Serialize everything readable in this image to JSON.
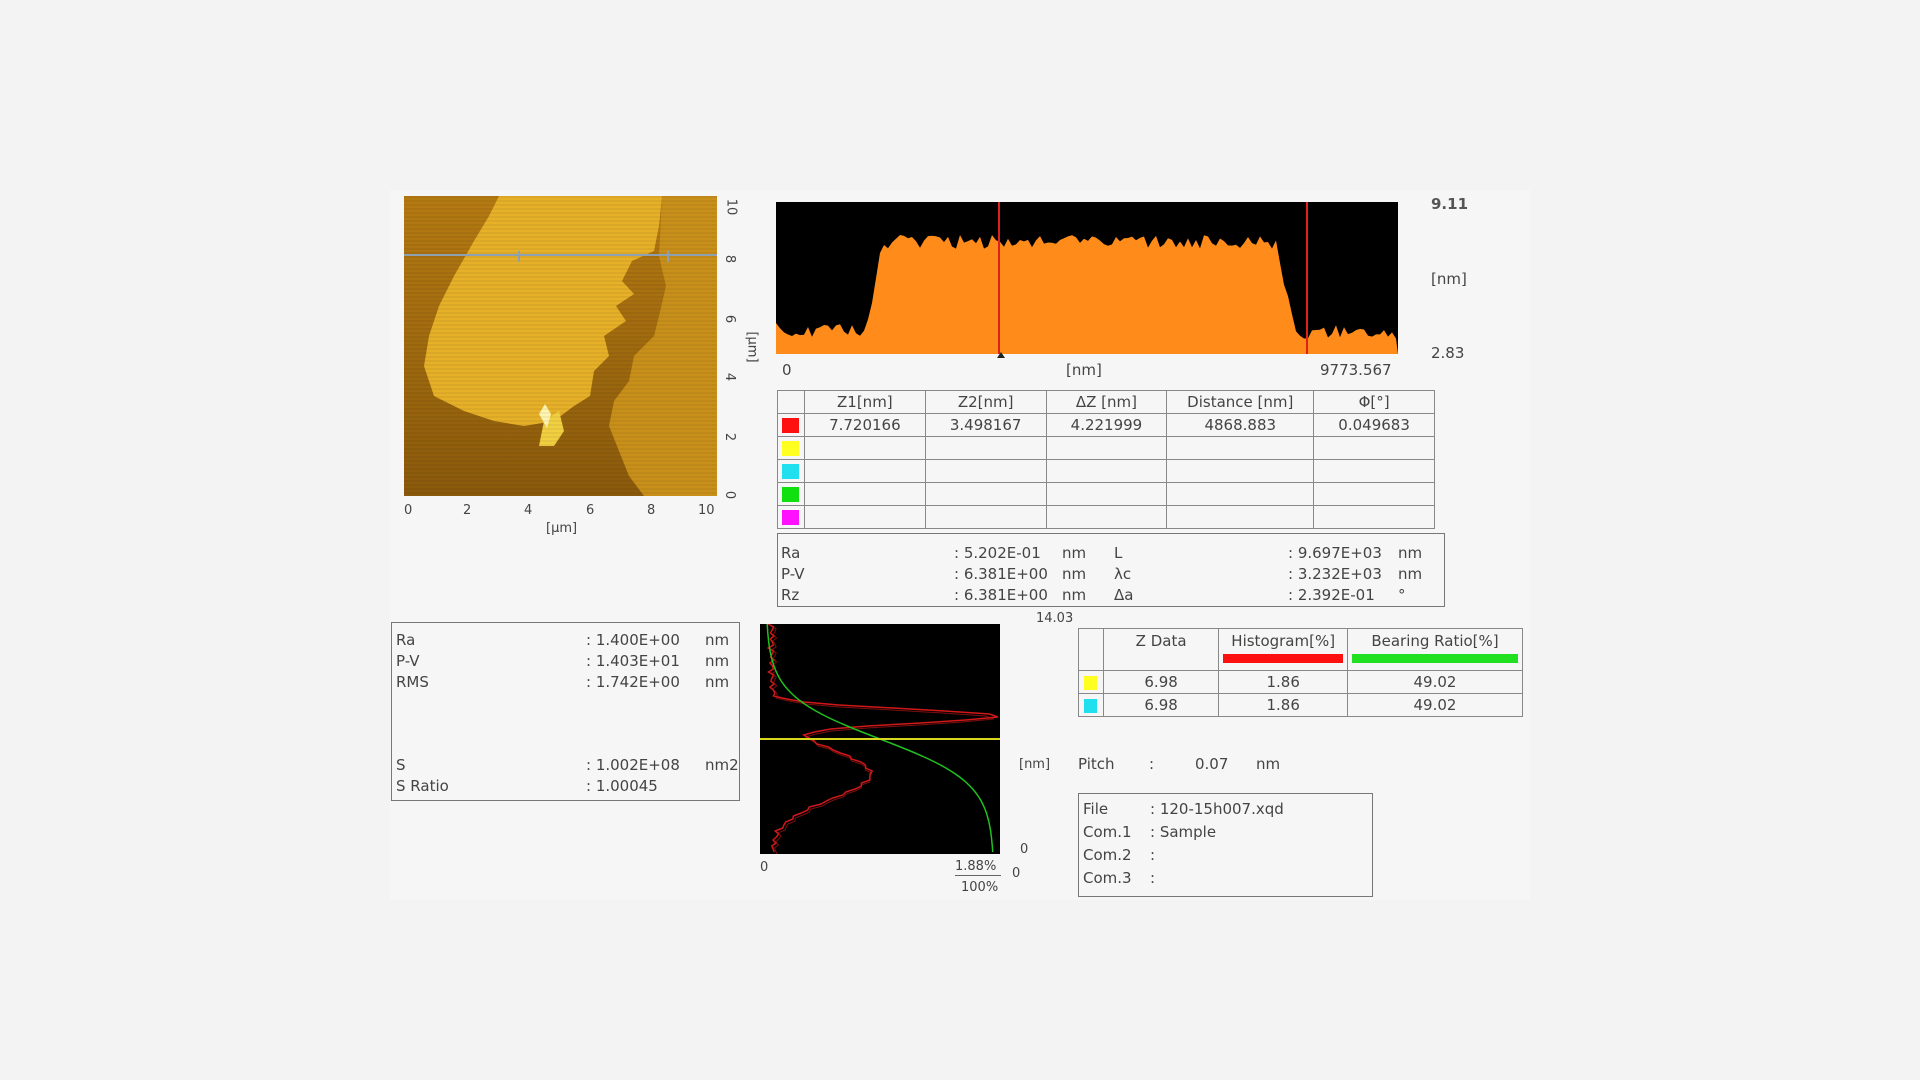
{
  "afm_image": {
    "x_ticks": [
      "0",
      "2",
      "4",
      "6",
      "8",
      "10"
    ],
    "y_ticks": [
      "10",
      "8",
      "6",
      "4",
      "2",
      "0"
    ],
    "x_unit": "[µm]",
    "y_unit": "[µm]"
  },
  "profile": {
    "z_max": "9.11",
    "z_min": "2.83",
    "z_unit": "[nm]",
    "x_start": "0",
    "x_end": "9773.567",
    "x_unit": "[nm]",
    "fill_color": "#ff8c1a",
    "cursor_color": "#e0201a"
  },
  "cursor_table": {
    "headers": [
      "Z1[nm]",
      "Z2[nm]",
      "ΔZ [nm]",
      "Distance [nm]",
      "Φ[°]"
    ],
    "rows": [
      {
        "color": "#ff1010",
        "cells": [
          "7.720166",
          "3.498167",
          "4.221999",
          "4868.883",
          "0.049683"
        ]
      },
      {
        "color": "#ffff20",
        "cells": [
          "",
          "",
          "",
          "",
          ""
        ]
      },
      {
        "color": "#20e0f0",
        "cells": [
          "",
          "",
          "",
          "",
          ""
        ]
      },
      {
        "color": "#10e010",
        "cells": [
          "",
          "",
          "",
          "",
          ""
        ]
      },
      {
        "color": "#ff10ff",
        "cells": [
          "",
          "",
          "",
          "",
          ""
        ]
      }
    ]
  },
  "line_roughness": {
    "left": [
      {
        "label": "Ra",
        "value": ": 5.202E-01",
        "unit": "nm"
      },
      {
        "label": "P-V",
        "value": ": 6.381E+00",
        "unit": "nm"
      },
      {
        "label": "Rz",
        "value": ": 6.381E+00",
        "unit": "nm"
      }
    ],
    "right": [
      {
        "label": "L",
        "value": ": 9.697E+03",
        "unit": "nm"
      },
      {
        "label": "λc",
        "value": ": 3.232E+03",
        "unit": "nm"
      },
      {
        "label": "Δa",
        "value": ": 2.392E-01",
        "unit": "°"
      }
    ]
  },
  "area_roughness": {
    "items": [
      {
        "label": "Ra",
        "value": ": 1.400E+00",
        "unit": "nm"
      },
      {
        "label": "P-V",
        "value": ": 1.403E+01",
        "unit": "nm"
      },
      {
        "label": "RMS",
        "value": ": 1.742E+00",
        "unit": "nm"
      },
      {
        "label": "S",
        "value": ": 1.002E+08",
        "unit": "nm2"
      },
      {
        "label": "S Ratio",
        "value": ": 1.00045",
        "unit": ""
      }
    ]
  },
  "histogram": {
    "top_label": "14.03",
    "unit_label": "[nm]",
    "right_zero": "0",
    "bottom_zero": "0",
    "x_start": "0",
    "pct_top": "1.88%",
    "pct_bottom": "100%",
    "bottom_right_zero": "0",
    "hist_color": "#d01818",
    "bearing_color": "#20c020",
    "cursor_color": "#d8d820"
  },
  "bearing_table": {
    "headers": [
      "Z Data",
      "Histogram[%]",
      "Bearing Ratio[%]"
    ],
    "bar_colors": [
      "#ff1010",
      "#20e020"
    ],
    "rows": [
      {
        "color": "#ffff20",
        "cells": [
          "6.98",
          "1.86",
          "49.02"
        ]
      },
      {
        "color": "#20e0f0",
        "cells": [
          "6.98",
          "1.86",
          "49.02"
        ]
      }
    ]
  },
  "pitch": {
    "label": "Pitch",
    "sep": ":",
    "value": "0.07",
    "unit": "nm"
  },
  "file_info": [
    {
      "label": "File",
      "value": ": 120-15h007.xqd"
    },
    {
      "label": "Com.1",
      "value": ": Sample"
    },
    {
      "label": "Com.2",
      "value": ":"
    },
    {
      "label": "Com.3",
      "value": ":"
    }
  ]
}
